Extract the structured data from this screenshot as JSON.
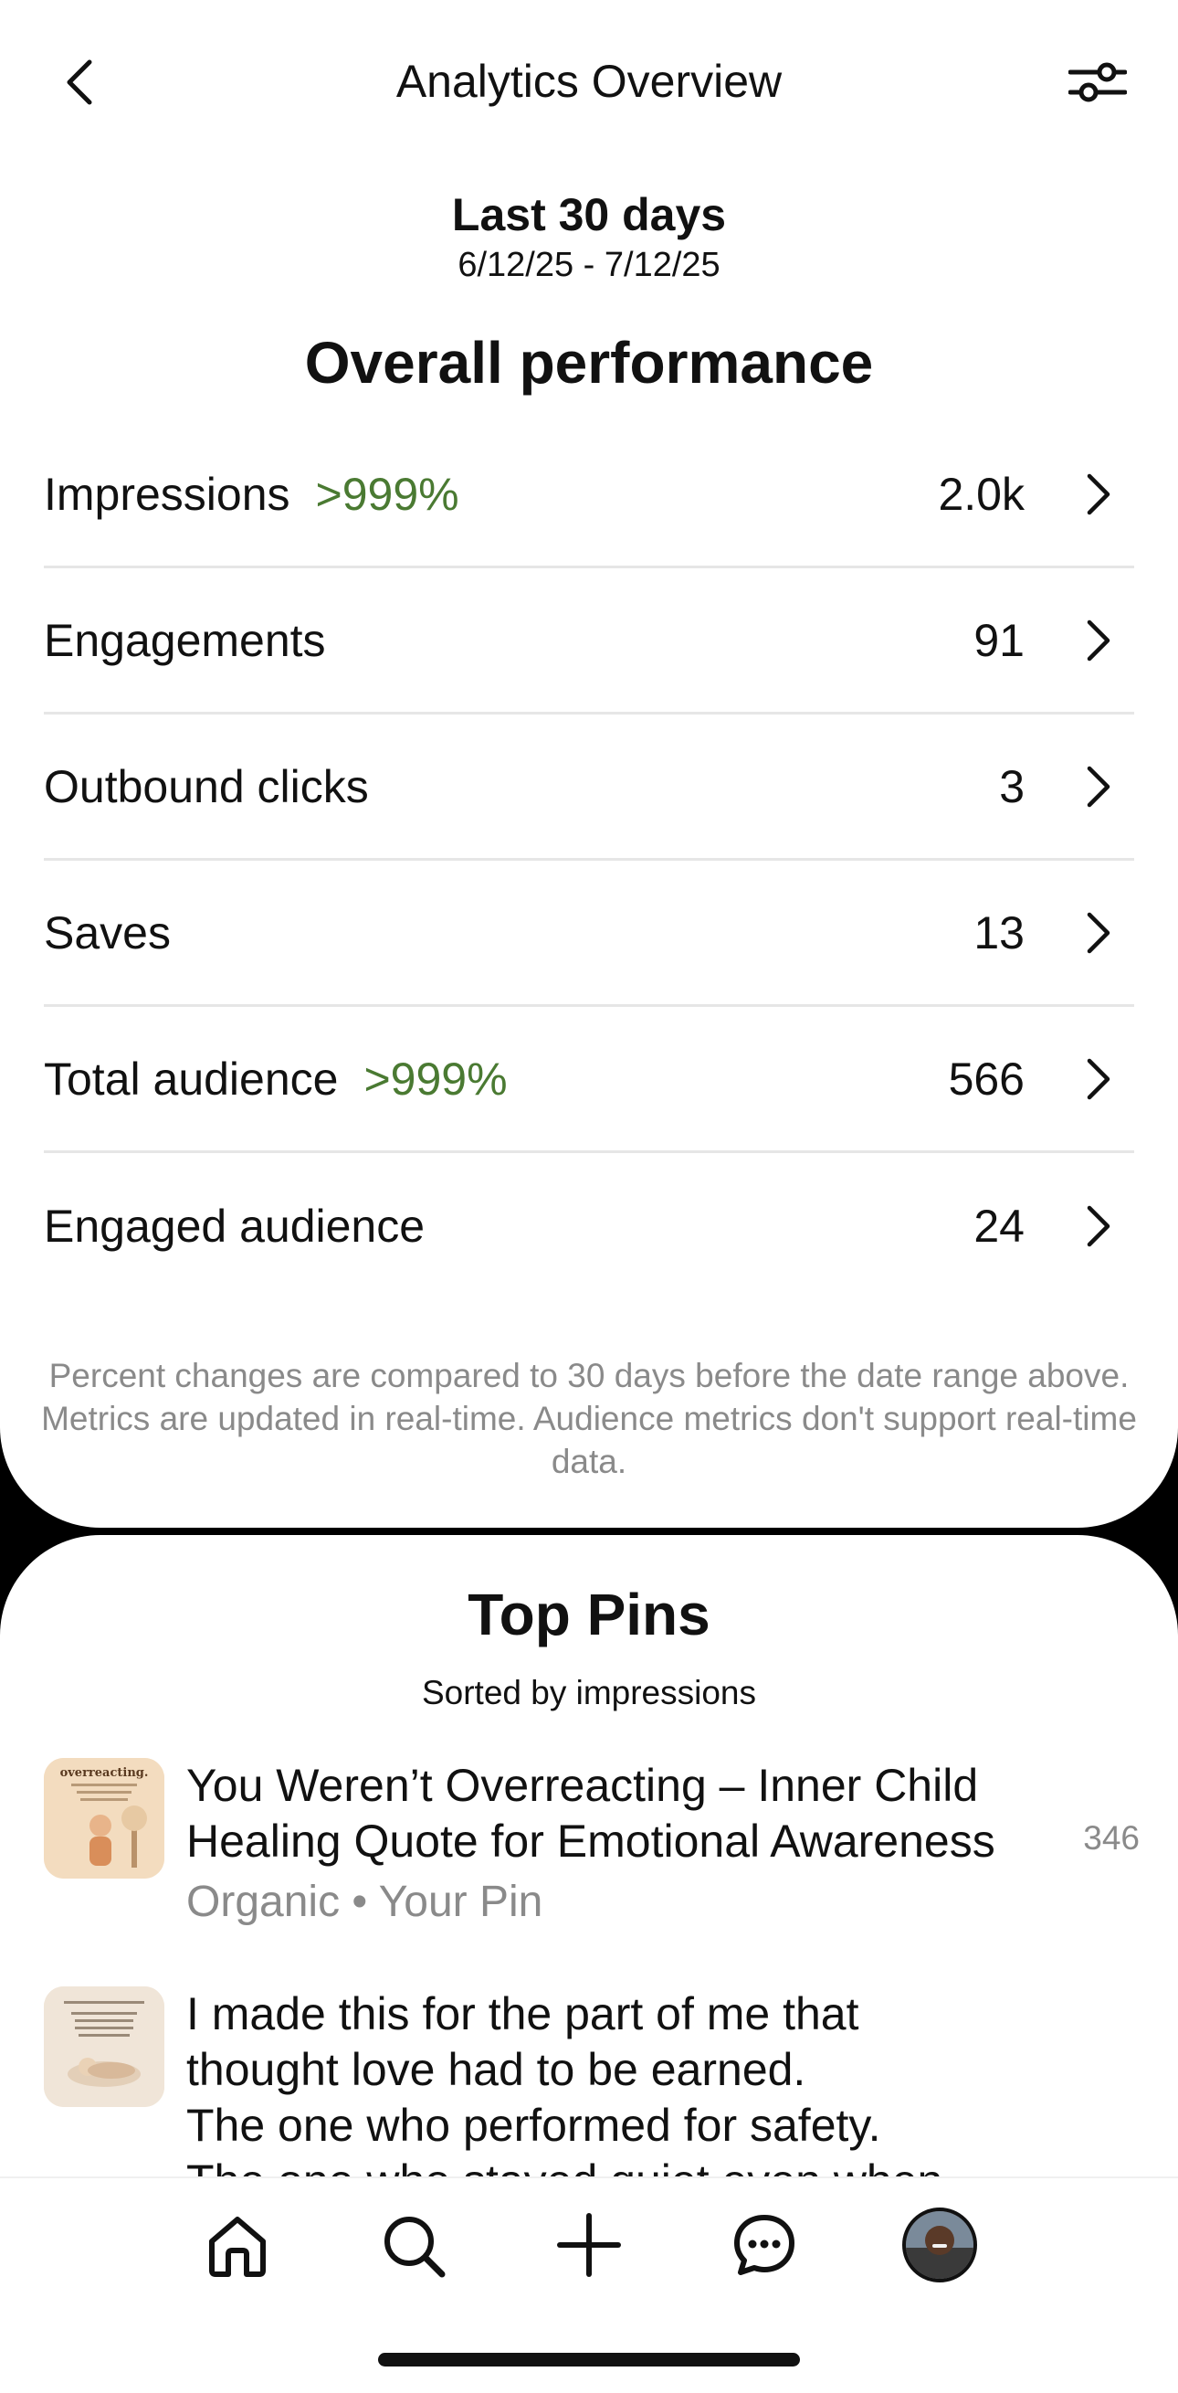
{
  "header": {
    "title": "Analytics Overview",
    "back_icon": "chevron-left-icon",
    "filter_icon": "sliders-icon"
  },
  "date_range": {
    "label": "Last 30 days",
    "dates": "6/12/25 - 7/12/25"
  },
  "overall": {
    "title": "Overall performance",
    "metrics": [
      {
        "label": "Impressions",
        "delta": ">999%",
        "value": "2.0k"
      },
      {
        "label": "Engagements",
        "delta": "",
        "value": "91"
      },
      {
        "label": "Outbound clicks",
        "delta": "",
        "value": "3"
      },
      {
        "label": "Saves",
        "delta": "",
        "value": "13"
      },
      {
        "label": "Total audience",
        "delta": ">999%",
        "value": "566"
      },
      {
        "label": "Engaged audience",
        "delta": "",
        "value": "24"
      }
    ],
    "footnote": "Percent changes are compared to 30 days before the date range above. Metrics are updated in real-time. Audience metrics don't support real-time data."
  },
  "colors": {
    "positive_delta": "#4a7a32",
    "muted_text": "#8a8a8a"
  },
  "top_pins": {
    "title": "Top Pins",
    "subtitle": "Sorted by impressions",
    "pins": [
      {
        "thumb_text": "overreacting.",
        "title": "You Weren’t Overreacting – Inner Child Healing Quote for Emotional Awareness",
        "count": "346",
        "meta": "Organic • Your Pin"
      },
      {
        "title_line1": "I made this for the part of me that",
        "title_line2": "thought love had to be earned.",
        "title_line3": "The one who performed for safety.",
        "title_line4": "The one who stayed quiet even when"
      }
    ]
  },
  "tabbar": {
    "items": [
      "home-icon",
      "search-icon",
      "create-plus-icon",
      "messages-icon",
      "profile-avatar"
    ]
  }
}
